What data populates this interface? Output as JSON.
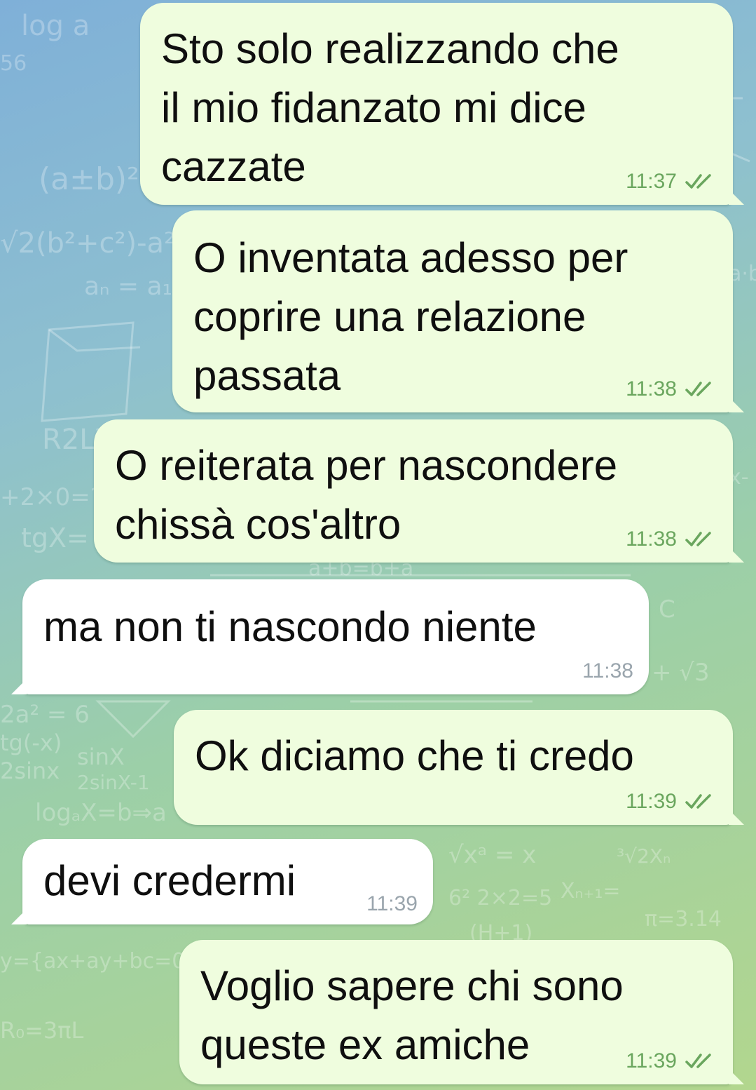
{
  "chat": {
    "messages": [
      {
        "direction": "out",
        "text": "Sto solo realizzando che\nil mio fidanzato mi dice\ncazzate",
        "time": "11:37",
        "status": "read"
      },
      {
        "direction": "out",
        "text": "O inventata adesso per\ncoprire una relazione\npassata",
        "time": "11:38",
        "status": "read"
      },
      {
        "direction": "out",
        "text": "O reiterata per nascondere\nchissà cos'altro",
        "time": "11:38",
        "status": "read"
      },
      {
        "direction": "in",
        "text": "ma non ti nascondo niente",
        "time": "11:38"
      },
      {
        "direction": "out",
        "text": "Ok diciamo che ti credo",
        "time": "11:39",
        "status": "read"
      },
      {
        "direction": "in",
        "text": "devi credermi",
        "time": "11:39"
      },
      {
        "direction": "out",
        "text": "Voglio sapere chi sono\nqueste ex amiche",
        "time": "11:39",
        "status": "read"
      }
    ]
  },
  "colors": {
    "outgoing_bubble": "#effdde",
    "incoming_bubble": "#ffffff",
    "read_check": "#6aa65e",
    "incoming_time": "#9aa5ad"
  },
  "icons": {
    "read_status": "double-check-icon",
    "background": "math-doodle-pattern"
  }
}
